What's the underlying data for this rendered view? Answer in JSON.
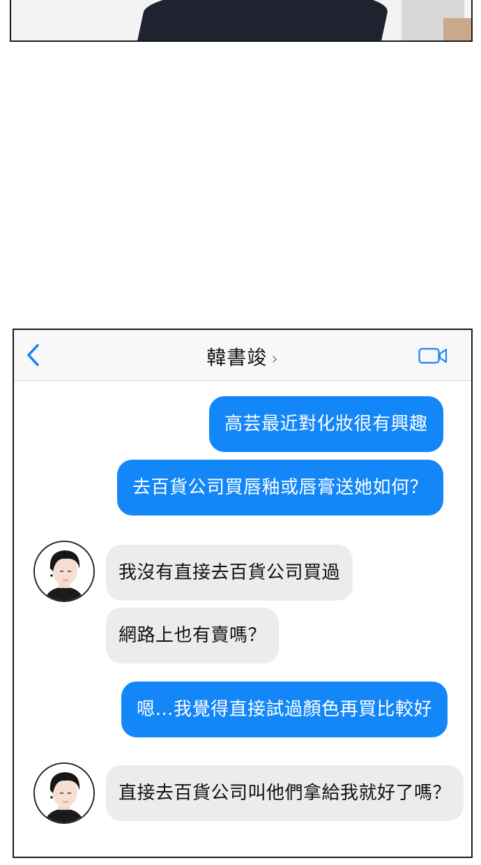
{
  "header": {
    "contact_name": "韓書竣",
    "contact_chevron": "›",
    "back_icon": "chevron-left-icon",
    "video_icon": "video-camera-icon",
    "accent_color": "#1386f8"
  },
  "messages": [
    {
      "direction": "outgoing",
      "text": "高芸最近對化妝很有興趣"
    },
    {
      "direction": "outgoing",
      "text": "去百貨公司買唇釉或唇膏送她如何？"
    },
    {
      "direction": "incoming",
      "text": "我沒有直接去百貨公司買過"
    },
    {
      "direction": "incoming",
      "text": "網路上也有賣嗎？"
    },
    {
      "direction": "outgoing",
      "text": "嗯…我覺得直接試過顏色再買比較好"
    },
    {
      "direction": "incoming",
      "text": "直接去百貨公司叫他們拿給我就好了嗎？"
    }
  ],
  "colors": {
    "outgoing_bubble": "#1386f8",
    "incoming_bubble": "#ececec"
  }
}
